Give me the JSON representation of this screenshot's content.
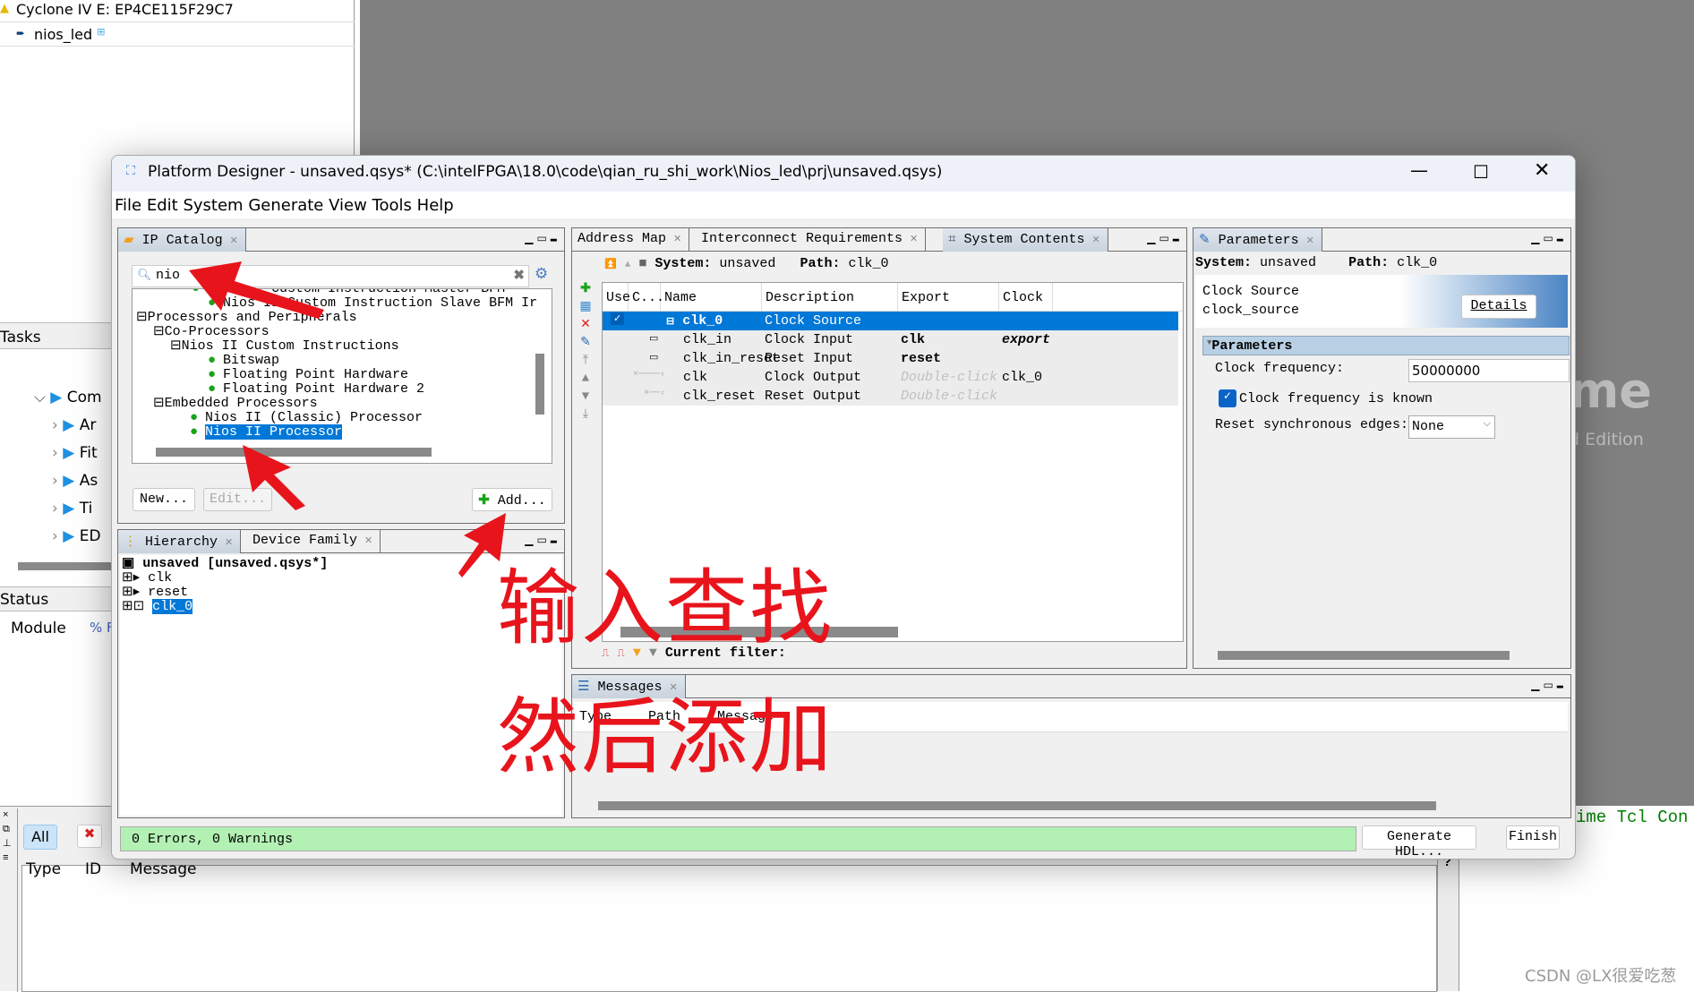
{
  "background": {
    "project_device": "Cyclone IV E: EP4CE115F29C7",
    "project_entity": "nios_led",
    "tasks_header": "Tasks",
    "task_rows": [
      "Com",
      "Ar",
      "Fit",
      "As",
      "Ti",
      "ED"
    ],
    "status_header": "Status",
    "status_columns": [
      "Module",
      "% F"
    ],
    "messages_filter_all": "All",
    "messages_columns": [
      "Type",
      "ID",
      "Message"
    ],
    "splash_big": "me",
    "splash_edition": "d Edition",
    "tcl_label": "ime Tcl Con",
    "help_mark": "?"
  },
  "window": {
    "title": "Platform Designer - unsaved.qsys* (C:\\intelFPGA\\18.0\\code\\qian_ru_shi_work\\Nios_led\\prj\\unsaved.qsys)",
    "menu": [
      "File",
      "Edit",
      "System",
      "Generate",
      "View",
      "Tools",
      "Help"
    ]
  },
  "ip_catalog": {
    "tab": "IP Catalog",
    "search_value": "nio",
    "tree": [
      {
        "text": "Nios II Custom Instruction Master BFM",
        "level": 3,
        "leaf": true,
        "clipped": true
      },
      {
        "text": "Nios II Custom Instruction Slave BFM Ir",
        "level": 3,
        "leaf": true
      },
      {
        "text": "Processors and Peripherals",
        "level": 0,
        "leaf": false
      },
      {
        "text": "Co-Processors",
        "level": 1,
        "leaf": false
      },
      {
        "text": "Nios II Custom Instructions",
        "level": 2,
        "leaf": false
      },
      {
        "text": "Bitswap",
        "level": 3,
        "leaf": true
      },
      {
        "text": "Floating Point Hardware",
        "level": 3,
        "leaf": true
      },
      {
        "text": "Floating Point Hardware 2",
        "level": 3,
        "leaf": true
      },
      {
        "text": "Embedded Processors",
        "level": 1,
        "leaf": false
      },
      {
        "text": "Nios II (Classic) Processor",
        "level": 2,
        "leaf": true
      },
      {
        "text": "Nios II Processor",
        "level": 2,
        "leaf": true,
        "selected": true
      }
    ],
    "new_label": "New...",
    "edit_label": "Edit...",
    "add_label": "Add..."
  },
  "hierarchy": {
    "tabs": [
      "Hierarchy",
      "Device Family"
    ],
    "root": "unsaved [unsaved.qsys*]",
    "items": [
      "clk",
      "reset",
      "clk_0"
    ]
  },
  "system_contents": {
    "tabs": [
      "Address Map",
      "Interconnect Requirements",
      "System Contents"
    ],
    "system_label": "System:",
    "system_value": "unsaved",
    "path_label": "Path:",
    "path_value": "clk_0",
    "columns": [
      "Use",
      "C...",
      "Name",
      "Description",
      "Export",
      "Clock"
    ],
    "rows": [
      {
        "name": "clk_0",
        "description": "Clock Source",
        "export": "",
        "clock": "",
        "selected": true,
        "use": true
      },
      {
        "name": "clk_in",
        "description": "Clock Input",
        "export": "clk",
        "clock": "export"
      },
      {
        "name": "clk_in_reset",
        "description": "Reset Input",
        "export": "reset",
        "clock": ""
      },
      {
        "name": "clk",
        "description": "Clock Output",
        "export": "Double-click",
        "clock": "clk_0"
      },
      {
        "name": "clk_reset",
        "description": "Reset Output",
        "export": "Double-click",
        "clock": ""
      }
    ],
    "filter_label": "Current filter:"
  },
  "parameters": {
    "tab": "Parameters",
    "system_label": "System:",
    "system_value": "unsaved",
    "path_label": "Path:",
    "path_value": "clk_0",
    "component_name": "Clock Source",
    "component_type": "clock_source",
    "details_label": "Details",
    "section": "Parameters",
    "clock_freq_label": "Clock frequency:",
    "clock_freq_value": "50000000",
    "clock_known_label": "Clock frequency is known",
    "clock_known": true,
    "reset_edges_label": "Reset synchronous edges:",
    "reset_edges_value": "None"
  },
  "messages": {
    "tab": "Messages",
    "columns": [
      "Type",
      "Path",
      "Message"
    ]
  },
  "status_bar": {
    "text": "0 Errors, 0 Warnings",
    "generate_label": "Generate HDL...",
    "finish_label": "Finish",
    "ok_color": "#b3f0b3"
  },
  "annotations": {
    "line1": "输入查找",
    "line2": "然后添加",
    "color": "#e8141c"
  },
  "watermark": "CSDN @LX很爱吃葱"
}
